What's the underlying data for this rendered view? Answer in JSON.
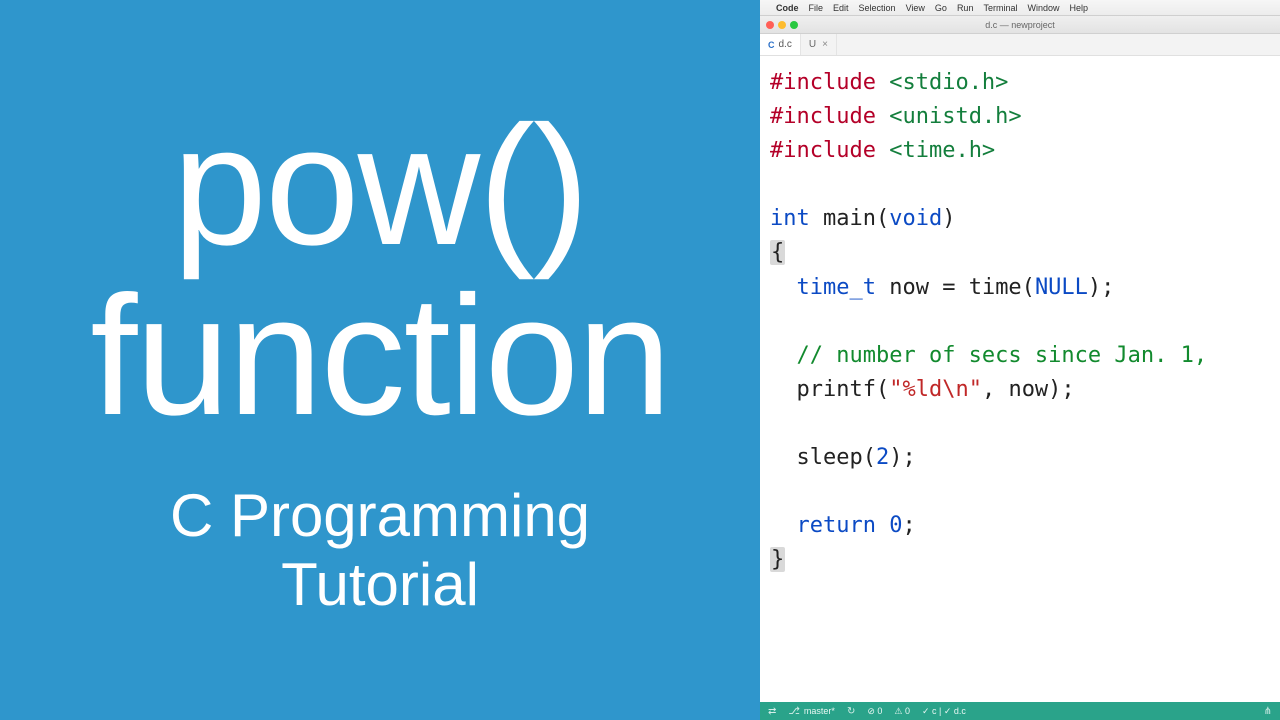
{
  "left": {
    "title_line1": "pow()",
    "title_line2": "function",
    "subtitle_line1": "C Programming",
    "subtitle_line2": "Tutorial"
  },
  "menubar": {
    "apple": "",
    "app_name": "Code",
    "items": [
      "File",
      "Edit",
      "Selection",
      "View",
      "Go",
      "Run",
      "Terminal",
      "Window",
      "Help"
    ]
  },
  "window": {
    "title": "d.c — newproject"
  },
  "tabs": {
    "active": {
      "lang": "C",
      "name": "d.c"
    },
    "secondary": {
      "label": "U",
      "close": "×"
    }
  },
  "code": {
    "include_kw": "#include",
    "hdr_stdio": "<stdio.h>",
    "hdr_unistd": "<unistd.h>",
    "hdr_time": "<time.h>",
    "int_kw": "int",
    "main_name": " main",
    "void_kw": "void",
    "open_brace": "{",
    "timet_kw": "time_t",
    "now_decl": " now = time(",
    "null_kw": "NULL",
    "decl_tail": ");",
    "comment": "// number of secs since Jan. 1,",
    "printf_name": "printf",
    "printf_open": "(",
    "printf_fmt": "\"%ld\\n\"",
    "printf_rest": ", now);",
    "sleep_call": "sleep(",
    "sleep_arg": "2",
    "sleep_tail": ");",
    "return_kw": "return",
    "return_val": "0",
    "return_tail": ";",
    "close_brace": "}"
  },
  "statusbar": {
    "remote_icon": "⇄",
    "branch_icon": "⎇",
    "branch": "master*",
    "sync": "↻",
    "errors": "⊘ 0",
    "warnings": "⚠ 0",
    "build": "✓ c | ✓ d.c",
    "right_icon": "⋔"
  }
}
